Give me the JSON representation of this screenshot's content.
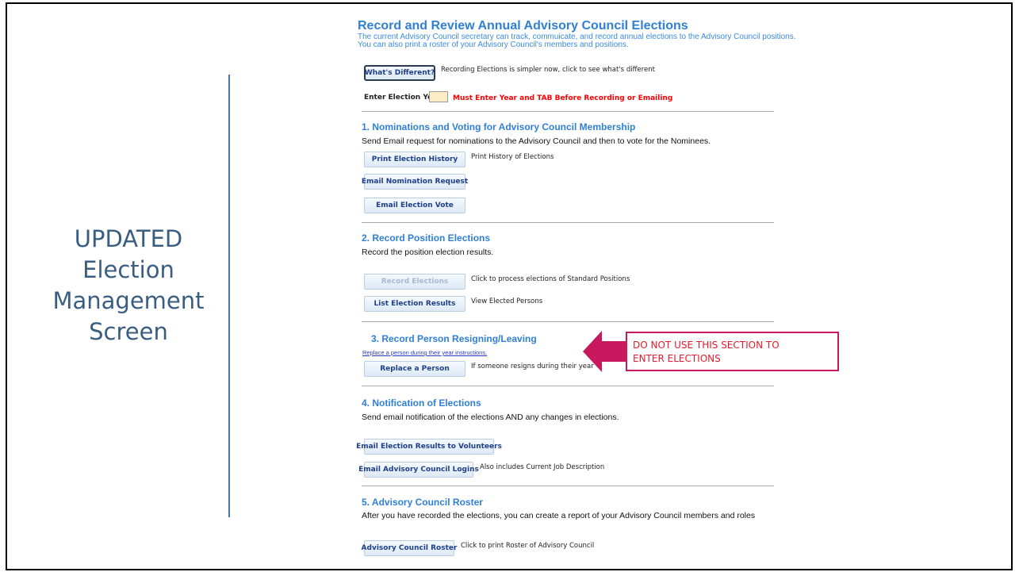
{
  "side_title": {
    "line1": "UPDATED",
    "line2": "Election",
    "line3": "Management",
    "line4": "Screen"
  },
  "page": {
    "title": "Record and Review Annual Advisory Council Elections",
    "intro_line1": "The current Advisory Council secretary can track, commuicate, and record annual elections to the Advisory Council positions.",
    "intro_line2": "You can also print a roster of your Advisory Council's members and positions."
  },
  "whats_different": {
    "label": "What's Different?",
    "note": "Recording Elections is simpler now, click to see what's different"
  },
  "election_year": {
    "label": "Enter Election Year:",
    "value": "",
    "warning": "Must Enter Year and TAB Before Recording or Emailing"
  },
  "section1": {
    "title": "1. Nominations and Voting for Advisory Council Membership",
    "desc": "Send Email request for nominations to the Advisory Council and then to vote for the Nominees.",
    "print_history_label": "Print Election History",
    "print_history_note": "Print History of Elections",
    "nomination_label": "Email Nomination Request",
    "vote_label": "Email Election Vote"
  },
  "section2": {
    "title": "2. Record Position Elections",
    "desc": "Record the position election results.",
    "record_label": "Record Elections",
    "record_note": "Click to process elections of Standard Positions",
    "list_label": "List Election Results",
    "list_note": "View Elected Persons"
  },
  "section3": {
    "title": "3. Record Person Resigning/Leaving",
    "link": "Replace a person during their year instructions.",
    "replace_label": "Replace a Person",
    "replace_note": "If someone resigns during their year"
  },
  "callout": {
    "line1": "DO NOT USE THIS SECTION TO",
    "line2": "ENTER ELECTIONS",
    "color": "#c8185e"
  },
  "section4": {
    "title": "4. Notification of Elections",
    "desc": "Send email notification of the elections AND any changes in elections.",
    "results_label": "Email Election Results to Volunteers",
    "logins_label": "Email Advisory Council Logins",
    "logins_note": "Also includes Current Job Description"
  },
  "section5": {
    "title": "5. Advisory Council Roster",
    "desc": "After you have recorded the elections, you can create a report of your Advisory Council members and roles",
    "roster_label": "Advisory Council Roster",
    "roster_note": "Click to print Roster of Advisory Council"
  }
}
